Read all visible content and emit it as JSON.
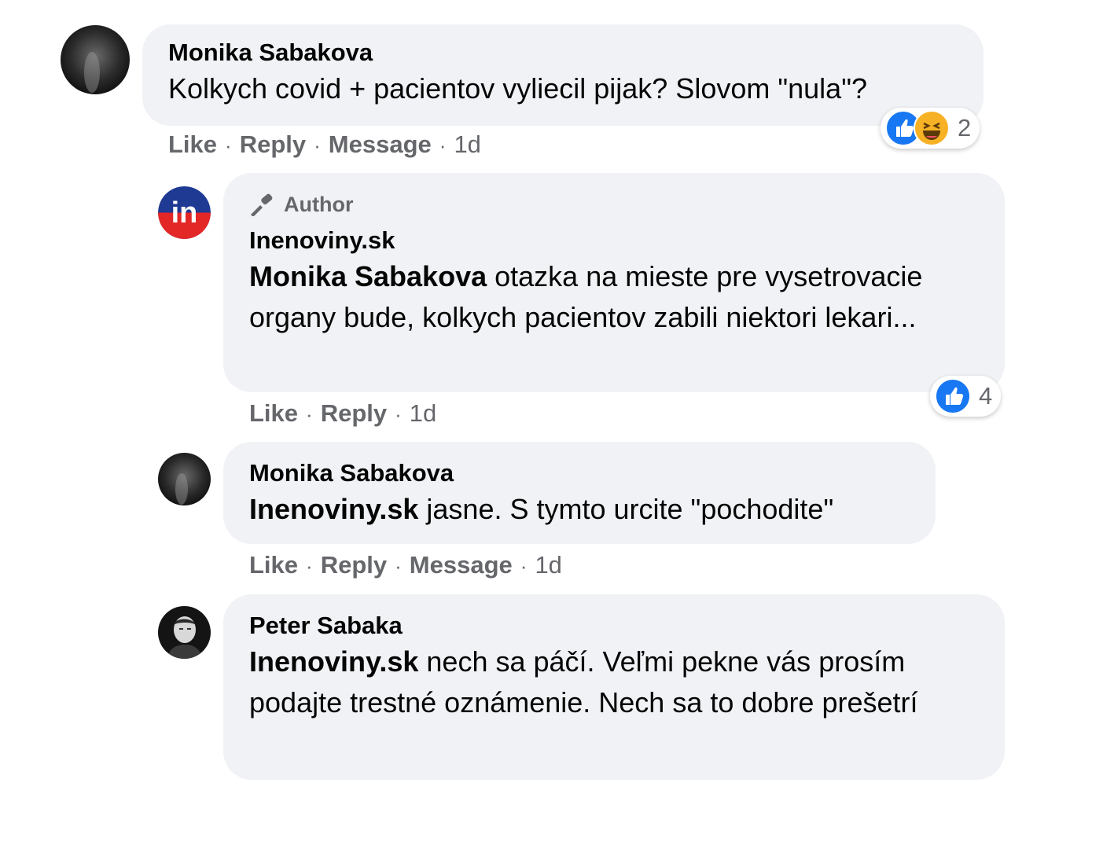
{
  "comments": [
    {
      "author": "Monika Sabakova",
      "text": "Kolkych covid + pacientov vyliecil pijak? Slovom \"nula\"?",
      "actions": {
        "like": "Like",
        "reply": "Reply",
        "message": "Message",
        "time": "1d"
      },
      "reactions": {
        "icons": [
          "like-icon",
          "haha-icon"
        ],
        "count": "2"
      }
    },
    {
      "badge": "Author",
      "author": "Inenoviny.sk",
      "mention": "Monika Sabakova",
      "text": " otazka na mieste pre vysetrovacie organy bude, kolkych pacientov zabili niektori lekari...",
      "actions": {
        "like": "Like",
        "reply": "Reply",
        "time": "1d"
      },
      "reactions": {
        "icons": [
          "like-icon"
        ],
        "count": "4"
      },
      "avatar_text": "in"
    },
    {
      "author": "Monika Sabakova",
      "mention": "Inenoviny.sk",
      "text": " jasne. S tymto urcite \"pochodite\"",
      "actions": {
        "like": "Like",
        "reply": "Reply",
        "message": "Message",
        "time": "1d"
      }
    },
    {
      "author": "Peter Sabaka",
      "mention": "Inenoviny.sk",
      "text": " nech sa páčí. Veľmi pekne vás prosím podajte trestné oznámenie. Nech sa to dobre prešetrí"
    }
  ],
  "separator": "·",
  "colors": {
    "bubble": "#f0f2f5",
    "meta": "#65676b",
    "like_blue": "#1877f2",
    "haha_yellow": "#f7b125",
    "brand_blue": "#1f3a93",
    "brand_red": "#e32626"
  }
}
